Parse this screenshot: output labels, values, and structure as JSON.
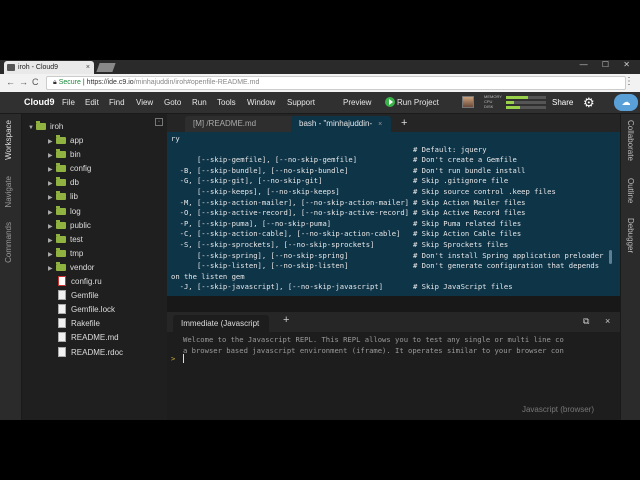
{
  "browser": {
    "tab_title": "iroh - Cloud9",
    "tab_close": "×",
    "window_controls": "— ☐ ✕",
    "back": "←",
    "forward": "→",
    "reload": "C",
    "secure_label": "Secure",
    "url_host": "https://ide.c9.io",
    "url_path": "/minhajuddin/iroh#openfile-README.md",
    "menu": "⋮"
  },
  "menubar": {
    "logo": "Cloud9",
    "items": [
      "File",
      "Edit",
      "Find",
      "View",
      "Goto",
      "Run",
      "Tools",
      "Window",
      "Support"
    ],
    "preview": "Preview",
    "run_project": "Run Project",
    "meters": [
      {
        "label": "MEMORY",
        "level": 0.55
      },
      {
        "label": "CPU",
        "level": 0.2
      },
      {
        "label": "DISK",
        "level": 0.35
      }
    ],
    "share": "Share",
    "gear": "⚙",
    "cloud": "☁"
  },
  "left_rail": {
    "tabs": [
      "Workspace",
      "Navigate",
      "Commands"
    ]
  },
  "right_rail": {
    "tabs": [
      "Collaborate",
      "Outline",
      "Debugger"
    ]
  },
  "workspace": {
    "collapse": "▫",
    "root": "iroh",
    "folders": [
      "app",
      "bin",
      "config",
      "db",
      "lib",
      "log",
      "public",
      "test",
      "tmp",
      "vendor"
    ],
    "files": [
      {
        "name": "config.ru",
        "type": "ruby"
      },
      {
        "name": "Gemfile",
        "type": "text"
      },
      {
        "name": "Gemfile.lock",
        "type": "text"
      },
      {
        "name": "Rakefile",
        "type": "text"
      },
      {
        "name": "README.md",
        "type": "text"
      },
      {
        "name": "README.rdoc",
        "type": "text"
      }
    ]
  },
  "editor": {
    "tabs": [
      {
        "label": "[M] /README.md",
        "active": false
      },
      {
        "label": "bash - \"minhajuddin-",
        "active": true
      }
    ],
    "close": "×",
    "plus": "+"
  },
  "terminal": {
    "lines": [
      {
        "left": "ry",
        "comment": ""
      },
      {
        "left": "",
        "comment": "# Default: jquery"
      },
      {
        "left": "      [--skip-gemfile], [--no-skip-gemfile]",
        "comment": "# Don't create a Gemfile"
      },
      {
        "left": "  -B, [--skip-bundle], [--no-skip-bundle]",
        "comment": "# Don't run bundle install"
      },
      {
        "left": "  -G, [--skip-git], [--no-skip-git]",
        "comment": "# Skip .gitignore file"
      },
      {
        "left": "      [--skip-keeps], [--no-skip-keeps]",
        "comment": "# Skip source control .keep files"
      },
      {
        "left": "  -M, [--skip-action-mailer], [--no-skip-action-mailer]",
        "comment": "# Skip Action Mailer files"
      },
      {
        "left": "  -O, [--skip-active-record], [--no-skip-active-record]",
        "comment": "# Skip Active Record files"
      },
      {
        "left": "  -P, [--skip-puma], [--no-skip-puma]",
        "comment": "# Skip Puma related files"
      },
      {
        "left": "  -C, [--skip-action-cable], [--no-skip-action-cable]",
        "comment": "# Skip Action Cable files"
      },
      {
        "left": "  -S, [--skip-sprockets], [--no-skip-sprockets]",
        "comment": "# Skip Sprockets files"
      },
      {
        "left": "      [--skip-spring], [--no-skip-spring]",
        "comment": "# Don't install Spring application preloader"
      },
      {
        "left": "      [--skip-listen], [--no-skip-listen]",
        "comment": "# Don't generate configuration that depends"
      },
      {
        "left": "on the listen gem",
        "comment": ""
      },
      {
        "left": "  -J, [--skip-javascript], [--no-skip-javascript]",
        "comment": "# Skip JavaScript files"
      }
    ]
  },
  "console": {
    "tab_label": "Immediate (Javascript",
    "plus": "+",
    "maximize": "⧉",
    "close": "×",
    "welcome_1": "Welcome to the Javascript REPL. This REPL allows you to test any single or multi line co",
    "welcome_2": "a browser based javascript environment (iframe). It operates similar to your browser con",
    "prompt": ">",
    "mode": "Javascript (browser)"
  }
}
